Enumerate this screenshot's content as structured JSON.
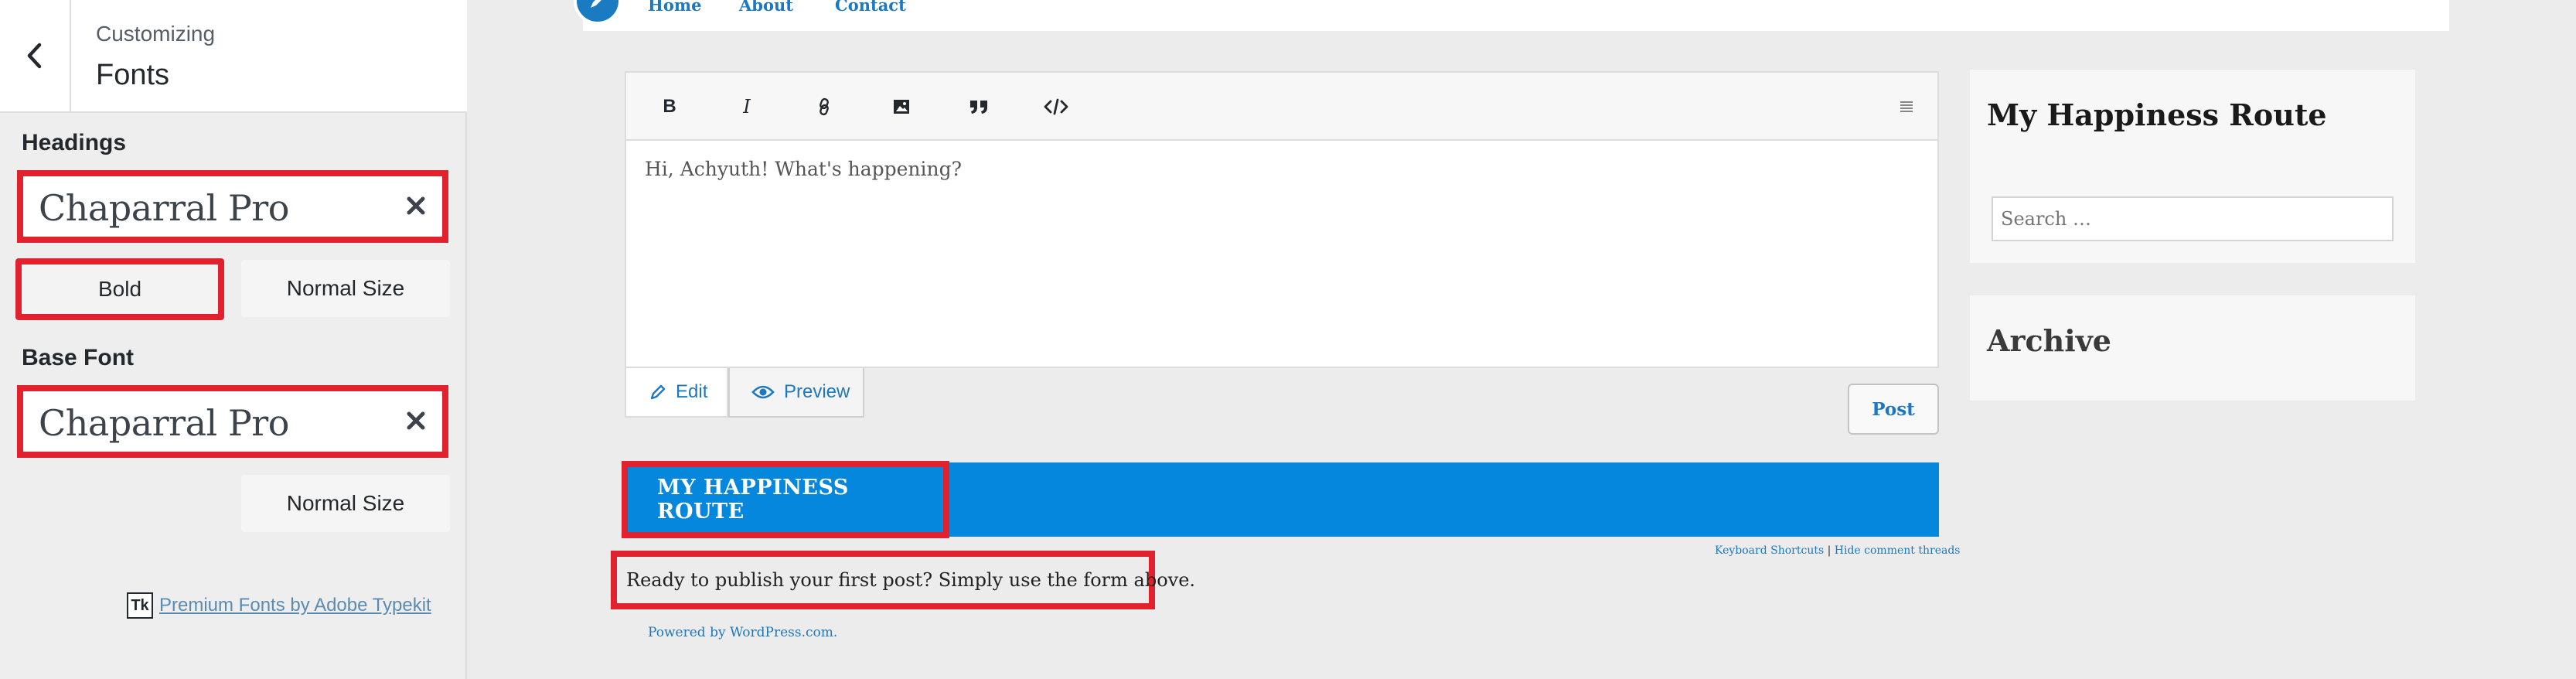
{
  "sidebar": {
    "subtitle": "Customizing",
    "title": "Fonts",
    "headings": {
      "label": "Headings",
      "font": "Chaparral Pro",
      "bold_label": "Bold",
      "size_label": "Normal Size"
    },
    "base": {
      "label": "Base Font",
      "font": "Chaparral Pro",
      "size_label": "Normal Size"
    },
    "typekit": {
      "logo": "Tk",
      "link": "Premium Fonts by Adobe Typekit"
    }
  },
  "nav": {
    "items": [
      "Home",
      "About",
      "Contact"
    ]
  },
  "editor": {
    "toolbar": {
      "bold": "B",
      "italic": "I"
    },
    "placeholder": "Hi, Achyuth! What's happening?",
    "tabs": {
      "edit": "Edit",
      "preview": "Preview"
    },
    "post_label": "Post"
  },
  "site": {
    "title": "MY HAPPINESS ROUTE",
    "keyboard_shortcuts": "Keyboard Shortcuts",
    "separator": "|",
    "hide_threads": "Hide comment threads",
    "ready_text": "Ready to publish your first post? Simply use the form above.",
    "powered": "Powered by WordPress.com."
  },
  "widgets": {
    "blog_title": "My Happiness Route",
    "search_placeholder": "Search …",
    "archive_title": "Archive"
  },
  "colors": {
    "accent": "#0587de",
    "link": "#1c78c0",
    "highlight": "#e2212e"
  }
}
